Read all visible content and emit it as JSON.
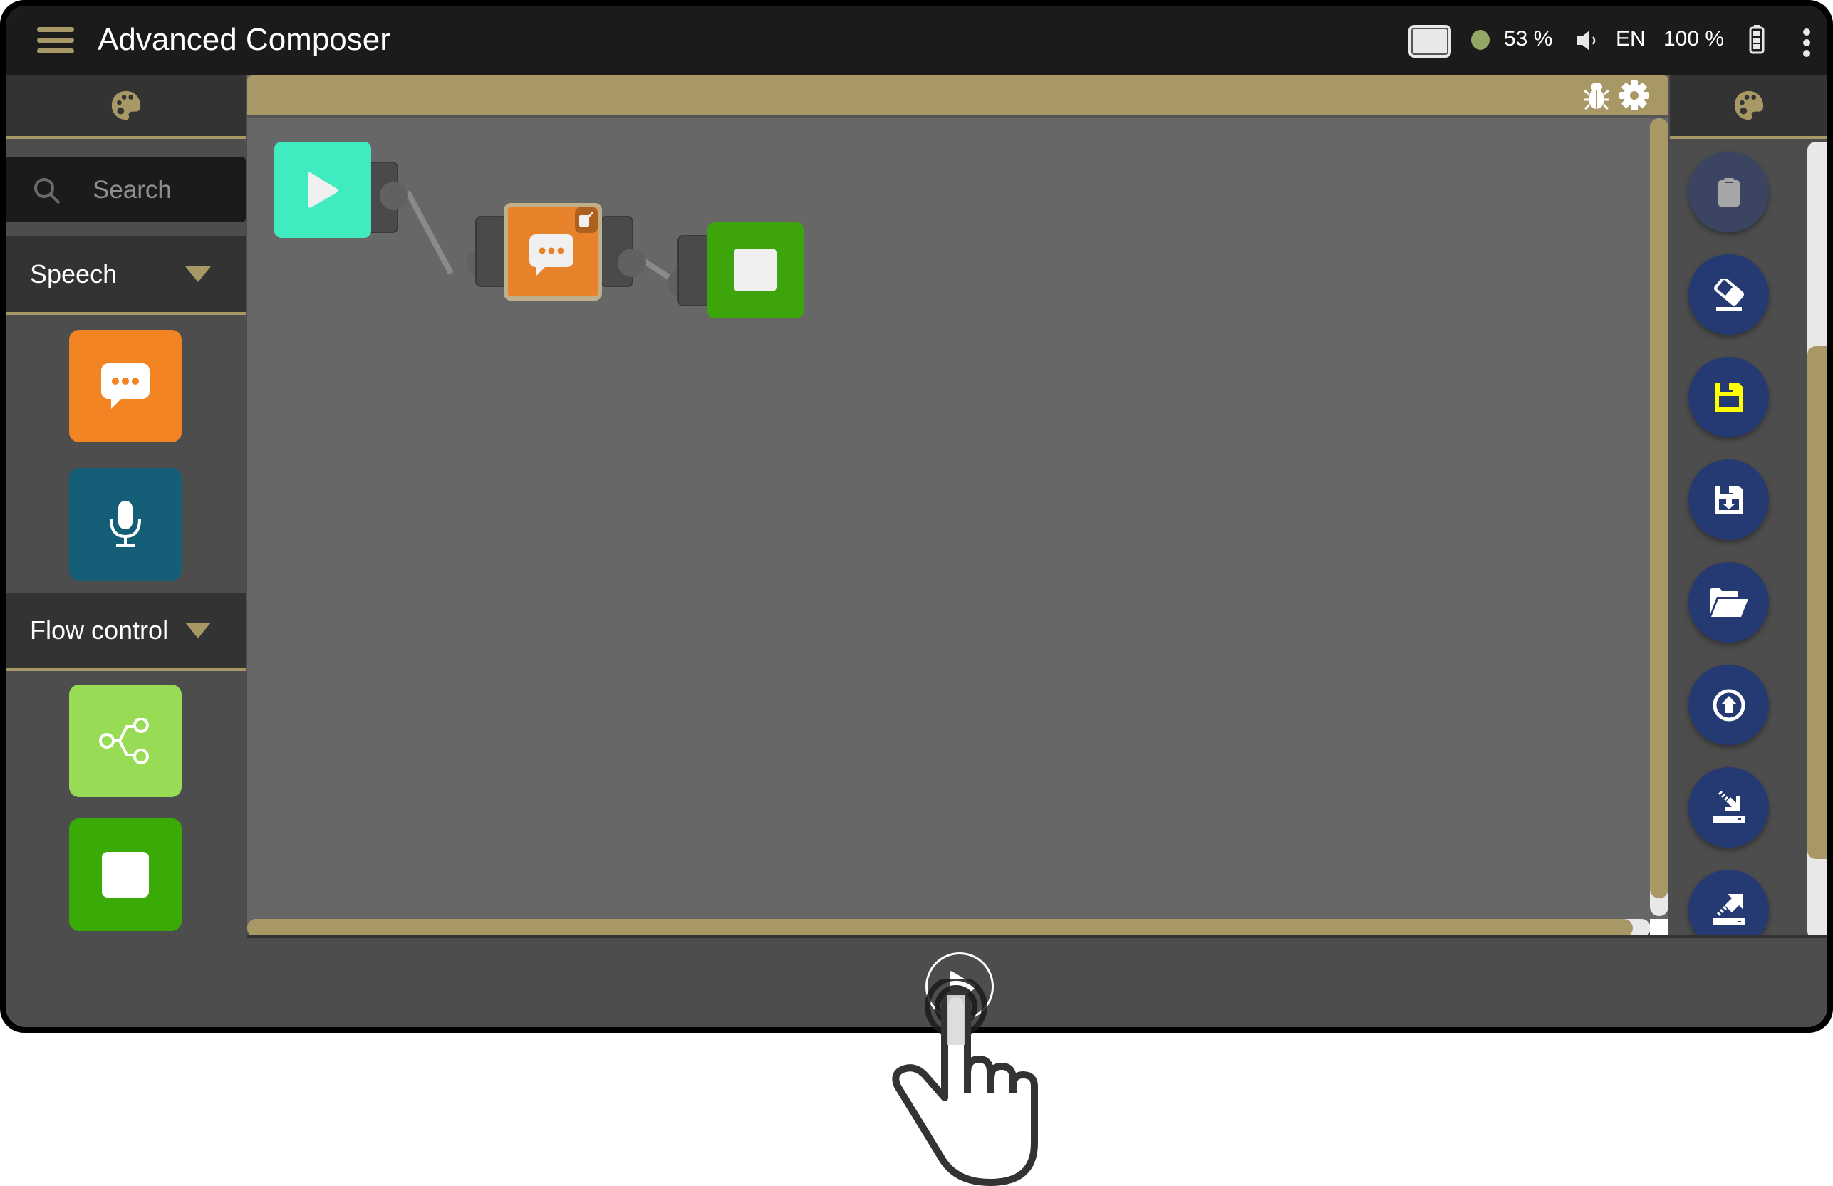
{
  "app": {
    "title": "Advanced Composer"
  },
  "status_bar": {
    "cpu_percent": "53 %",
    "language": "EN",
    "battery_percent": "100 %",
    "indicator_color": "#94a865"
  },
  "left_palette": {
    "search": {
      "placeholder": "Search",
      "value": ""
    },
    "categories": [
      {
        "label": "Speech",
        "expanded": true,
        "blocks": [
          {
            "name": "say",
            "icon": "speech-bubble-icon",
            "color": "#f28423"
          },
          {
            "name": "listen",
            "icon": "microphone-icon",
            "color": "#155e78"
          }
        ]
      },
      {
        "label": "Flow control",
        "expanded": true,
        "blocks": [
          {
            "name": "branch",
            "icon": "branch-icon",
            "color": "#98dc55"
          },
          {
            "name": "stop",
            "icon": "stop-icon",
            "color": "#3aab06"
          }
        ]
      }
    ]
  },
  "canvas": {
    "toolbar_icons": [
      "bug-icon",
      "gear-icon"
    ],
    "nodes": [
      {
        "id": "start",
        "type": "play",
        "color": "#40ecbf"
      },
      {
        "id": "say",
        "type": "speech",
        "color": "#e8822a",
        "selected": true,
        "has_edit_badge": true
      },
      {
        "id": "end",
        "type": "stop",
        "color": "#3ea40c"
      }
    ],
    "edges": [
      {
        "from": "start",
        "to": "say"
      },
      {
        "from": "say",
        "to": "end"
      }
    ]
  },
  "right_toolbar": {
    "buttons": [
      {
        "name": "paste",
        "icon": "clipboard-icon",
        "enabled": false
      },
      {
        "name": "clear",
        "icon": "eraser-icon",
        "enabled": true
      },
      {
        "name": "save",
        "icon": "floppy-icon",
        "enabled": true,
        "highlight": "#ffff00"
      },
      {
        "name": "save-as",
        "icon": "floppy-download-icon",
        "enabled": true
      },
      {
        "name": "open",
        "icon": "folder-open-icon",
        "enabled": true
      },
      {
        "name": "upload",
        "icon": "upload-circle-icon",
        "enabled": true
      },
      {
        "name": "import",
        "icon": "import-icon",
        "enabled": true
      },
      {
        "name": "export",
        "icon": "export-icon",
        "enabled": true
      }
    ]
  },
  "bottom_bar": {
    "run_icon": "play-circle-icon"
  },
  "colors": {
    "accent": "#a89866",
    "topbar": "#1b1b1b",
    "canvas": "#676767",
    "tool_button": "#253a72"
  }
}
